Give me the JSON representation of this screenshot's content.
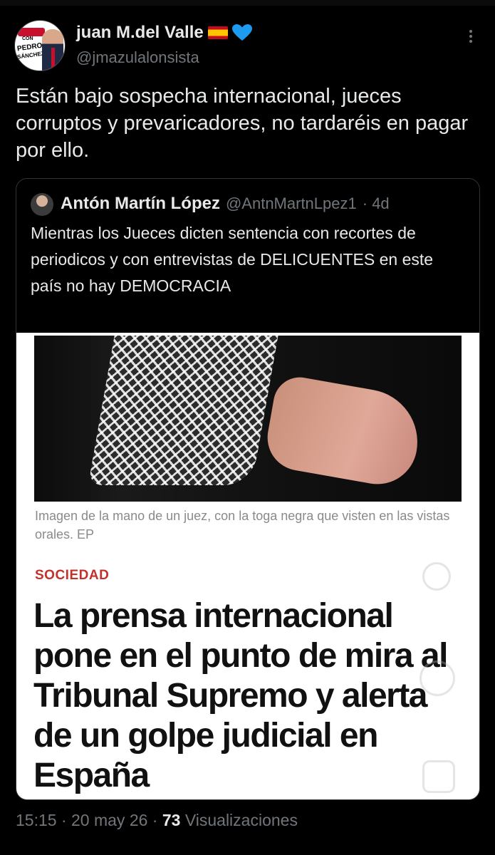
{
  "author": {
    "name": "juan M.del Valle",
    "handle": "@jmazulalonsista",
    "avatar_text": {
      "top": "CON",
      "line1": "PEDRO",
      "line2": "SÁNCHEZ"
    },
    "heart_color": "#1d9bf0"
  },
  "tweet": {
    "text": "Están bajo sospecha internacional, jueces corruptos y prevaricadores, no tardaréis en pagar por ello."
  },
  "quoted": {
    "name": "Antón Martín López",
    "handle": "@AntnMartnLpez1",
    "time": "· 4d",
    "text": "Mientras los Jueces dicten sentencia con recortes de periodicos y con entrevistas de DELICUENTES en este país no hay DEMOCRACIA",
    "article": {
      "caption": "Imagen de la mano de un juez, con la toga negra que visten en las vistas orales. EP",
      "section": "SOCIEDAD",
      "headline": "La prensa internacional pone en el punto de mira al Tribunal Supremo y alerta de un golpe judicial en España"
    }
  },
  "footer": {
    "time": "15:15",
    "date": "· 20 may 26 ·",
    "views_count": "73",
    "views_label": "Visualizaciones"
  },
  "colors": {
    "background": "#000000",
    "text": "#e7e9ea",
    "muted": "#71767b",
    "section_red": "#c3312a"
  }
}
